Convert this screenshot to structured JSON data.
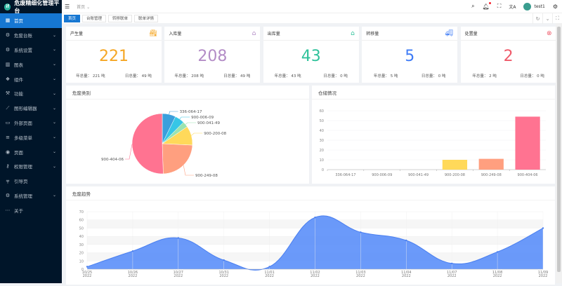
{
  "app": {
    "title": "危废精细化管理平台",
    "logo_text": "if"
  },
  "sidebar": {
    "items": [
      {
        "label": "首页",
        "icon": "grid-icon",
        "active": true,
        "chevron": false
      },
      {
        "label": "危废台账",
        "icon": "gear-icon",
        "chevron": true
      },
      {
        "label": "系统设置",
        "icon": "gear-icon",
        "chevron": true
      },
      {
        "label": "图表",
        "icon": "bar-chart-icon",
        "chevron": true
      },
      {
        "label": "组件",
        "icon": "component-icon",
        "chevron": true
      },
      {
        "label": "功能",
        "icon": "function-icon",
        "chevron": true
      },
      {
        "label": "图形编辑器",
        "icon": "line-chart-icon",
        "chevron": true
      },
      {
        "label": "外部页面",
        "icon": "monitor-icon",
        "chevron": true
      },
      {
        "label": "多级菜单",
        "icon": "menu-icon",
        "chevron": true
      },
      {
        "label": "页面",
        "icon": "page-icon",
        "chevron": true
      },
      {
        "label": "权限管理",
        "icon": "key-icon",
        "chevron": true
      },
      {
        "label": "引导页",
        "icon": "paint-roller-icon",
        "chevron": false
      },
      {
        "label": "系统管理",
        "icon": "gear-icon",
        "chevron": true
      },
      {
        "label": "关于",
        "icon": "dots-icon",
        "chevron": false
      }
    ]
  },
  "header": {
    "breadcrumb": "首页",
    "user": "test1"
  },
  "tabs": [
    {
      "label": "首页",
      "active": true
    },
    {
      "label": "台账管理"
    },
    {
      "label": "转移联单"
    },
    {
      "label": "联单详情"
    }
  ],
  "stats": [
    {
      "title": "产生量",
      "value": "221",
      "year_label": "年总量：",
      "year": "221 吨",
      "day_label": "日总量：",
      "day": "49 吨",
      "color": "#f5a623",
      "icon": "factory-icon"
    },
    {
      "title": "入库量",
      "value": "208",
      "year_label": "年总量：",
      "year": "208 吨",
      "day_label": "日总量：",
      "day": "49 吨",
      "color": "#b38cc6",
      "icon": "warehouse-in-icon"
    },
    {
      "title": "出库量",
      "value": "43",
      "year_label": "年总量：",
      "year": "43 吨",
      "day_label": "日总量：",
      "day": "0 吨",
      "color": "#2fc29b",
      "icon": "warehouse-out-icon"
    },
    {
      "title": "转移量",
      "value": "5",
      "year_label": "年总量：",
      "year": "5 吨",
      "day_label": "日总量：",
      "day": "0 吨",
      "color": "#3f7cf6",
      "icon": "truck-icon"
    },
    {
      "title": "处置量",
      "value": "2",
      "year_label": "年总量：",
      "year": "2 吨",
      "day_label": "日总量：",
      "day": "0 吨",
      "color": "#ef5a6a",
      "icon": "lifebuoy-icon"
    }
  ],
  "chart_data": [
    {
      "type": "pie",
      "title": "危废类别",
      "categories": [
        "336-064-17",
        "900-006-09",
        "900-041-49",
        "900-200-08",
        "900-249-08",
        "900-404-06"
      ],
      "values": [
        7,
        5,
        3,
        10,
        23,
        49
      ],
      "colors": [
        "#3a9fdc",
        "#36c6e6",
        "#9be3b0",
        "#ffd95a",
        "#ff9f7f",
        "#ff7391"
      ]
    },
    {
      "type": "bar",
      "title": "仓储情况",
      "categories": [
        "336-064-17",
        "900-006-09",
        "900-041-49",
        "900-200-08",
        "900-249-08",
        "900-404-06"
      ],
      "values": [
        0,
        0,
        0,
        10,
        11,
        54
      ],
      "ylim": [
        0,
        60
      ],
      "yticks": [
        0,
        10,
        20,
        30,
        40,
        50,
        60
      ],
      "colors": [
        "#3a9fdc",
        "#36c6e6",
        "#9be3b0",
        "#ffd95a",
        "#ff9f7f",
        "#ff7391"
      ]
    },
    {
      "type": "area",
      "title": "危废趋势",
      "categories": [
        "10/25",
        "10/26",
        "10/27",
        "10/31",
        "11/01",
        "11/02",
        "11/03",
        "11/04",
        "11/07",
        "11/08",
        "11/09"
      ],
      "year": "2022",
      "values": [
        3,
        22,
        38,
        11,
        3,
        63,
        45,
        35,
        7,
        21,
        50
      ],
      "ylim": [
        0,
        70
      ],
      "yticks": [
        0,
        10,
        20,
        30,
        40,
        50,
        60,
        70
      ],
      "color": "#5b8ff9"
    }
  ]
}
